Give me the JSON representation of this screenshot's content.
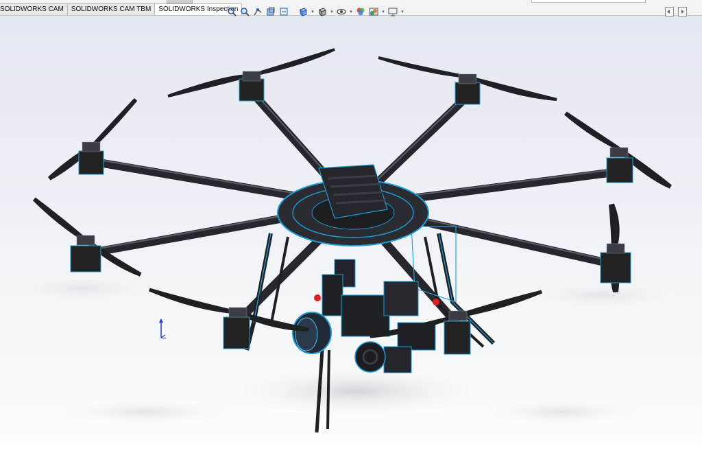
{
  "tabs": [
    {
      "label": "SOLIDWORKS CAM",
      "active": false
    },
    {
      "label": "SOLIDWORKS CAM TBM",
      "active": false
    },
    {
      "label": "SOLIDWORKS Inspection",
      "active": true
    }
  ],
  "heads_up_toolbar": {
    "icons": [
      "zoom-to-fit-icon",
      "zoom-to-area-icon",
      "previous-view-icon",
      "section-view-icon",
      "dynamic-annotation-icon",
      "view-orientation-icon",
      "display-style-icon",
      "hide-show-items-icon",
      "edit-appearance-icon",
      "apply-scene-icon",
      "view-settings-icon"
    ]
  },
  "viewport": {
    "model": "octocopter-drone-with-camera-gimbal",
    "background_top": "#e4e8f0",
    "background_bottom": "#ffffff",
    "frame_color": "#2b2d31",
    "accent_edges": "#1f9bd6"
  }
}
